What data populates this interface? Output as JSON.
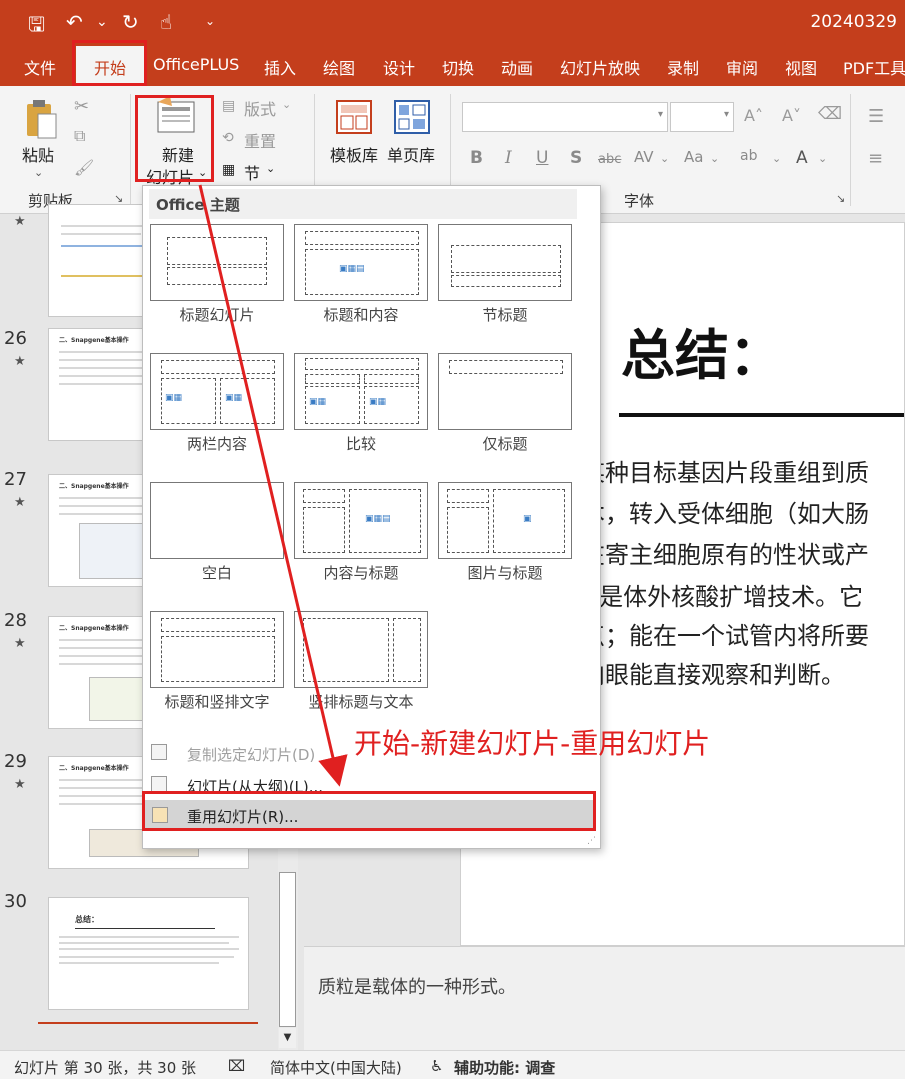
{
  "window": {
    "title": "20240329"
  },
  "quick_access": {
    "save": "🖫",
    "undo": "↶",
    "undo_more": "⌄",
    "redo": "↻",
    "touch": "☝",
    "customize": "⌄"
  },
  "tabs": [
    "文件",
    "开始",
    "OfficePLUS",
    "插入",
    "绘图",
    "设计",
    "切换",
    "动画",
    "幻灯片放映",
    "录制",
    "审阅",
    "视图",
    "PDF工具"
  ],
  "active_tab": "开始",
  "ribbon": {
    "paste_label": "粘贴",
    "clipboard_group": "剪贴板",
    "new_slide_line1": "新建",
    "new_slide_line2": "幻灯片",
    "layout_label": "版式",
    "reset_label": "重置",
    "section_label": "节",
    "template_label": "模板库",
    "single_page_label": "单页库",
    "font_group": "字体",
    "font_buttons": [
      "B",
      "I",
      "U",
      "S",
      "abc",
      "AV",
      "Aa",
      "ab",
      "A"
    ]
  },
  "dropdown": {
    "header": "Office 主题",
    "layouts": [
      "标题幻灯片",
      "标题和内容",
      "节标题",
      "两栏内容",
      "比较",
      "仅标题",
      "空白",
      "内容与标题",
      "图片与标题",
      "标题和竖排文字",
      "竖排标题与文本"
    ],
    "menu": {
      "duplicate": "复制选定幻灯片(D)",
      "from_outline": "幻灯片(从大纲)(L)...",
      "reuse": "重用幻灯片(R)..."
    }
  },
  "thumbnails": {
    "numbers": [
      "26",
      "27",
      "28",
      "29",
      "30"
    ],
    "heads": [
      "二、Snapgene基本操作",
      "二、Snapgene基本操作",
      "二、Snapgene基本操作",
      "二、Snapgene基本操作",
      "总结："
    ]
  },
  "slide": {
    "title": "总结：",
    "lines": [
      "某种目标基因片段重组到质",
      "本，转入受体细胞（如大肠",
      "在寄主细胞原有的性状或产",
      "R是体外核酸扩增技术。它",
      "点；能在一个试管内将所要",
      "肉眼能直接观察和判断。"
    ]
  },
  "notes": "质粒是载体的一种形式。",
  "status": {
    "slide_count": "幻灯片 第 30 张，共 30 张",
    "language": "简体中文(中国大陆)",
    "accessibility": "辅助功能: 调查"
  },
  "annotation": "开始-新建幻灯片-重用幻灯片",
  "colors": {
    "accent": "#c43e1c",
    "annotation": "#e02020"
  }
}
